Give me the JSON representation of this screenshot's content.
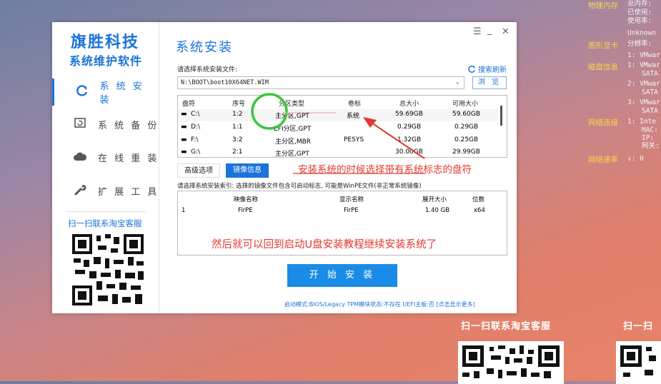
{
  "desktop": {
    "sysinfo": [
      {
        "key": "物理内存",
        "values": [
          "总内存:",
          "已使用:",
          "使用率:",
          "Unknown"
        ]
      },
      {
        "key": "图形显卡",
        "values": [
          "分辨率:",
          "1: VMwar"
        ]
      },
      {
        "key": "磁盘信息",
        "values": [
          "1: VMwar",
          "SATA",
          "2: VMwar",
          "SATA",
          "3: VMwar",
          "SATA"
        ]
      },
      {
        "key": "网络连接",
        "values": [
          "1: Inte",
          "MAC:",
          "IP:",
          "网关:"
        ]
      },
      {
        "key": "网络速率",
        "values": [
          "↓: 0"
        ]
      }
    ],
    "qr_label_1": "扫一扫联系淘宝客服",
    "qr_label_2": "扫一扫"
  },
  "window": {
    "brand_line1": "旗胜科技",
    "brand_line2": "系统维护软件",
    "nav": [
      {
        "label": "系 统 安 装",
        "icon": "refresh-icon",
        "active": true
      },
      {
        "label": "系 统 备 份",
        "icon": "backup-icon",
        "active": false
      },
      {
        "label": "在 线 重 装",
        "icon": "cloud-icon",
        "active": false
      },
      {
        "label": "扩 展 工 具",
        "icon": "wrench-icon",
        "active": false
      }
    ],
    "side_qr_label": "扫一扫联系淘宝客服",
    "controls": {
      "menu": "☰",
      "minimize": "_",
      "close": "✕"
    },
    "title": "系统安装",
    "select_file_label": "请选择系统安装文件:",
    "search_refresh": "搜索刷新",
    "file_path": "N:\\BOOT\\boot10X64NET.WIM",
    "browse_label": "浏 览",
    "partition_headers": [
      "盘符",
      "序号",
      "分区类型",
      "卷标",
      "总大小",
      "可用大小"
    ],
    "partitions": [
      {
        "drive": "C:\\",
        "index": "1:2",
        "type": "主分区,GPT",
        "label": "系统",
        "total": "59.69GB",
        "free": "59.60GB"
      },
      {
        "drive": "D:\\",
        "index": "1:1",
        "type": "EFI分区,GPT",
        "label": "",
        "total": "0.29GB",
        "free": "0.29GB"
      },
      {
        "drive": "F:\\",
        "index": "3:2",
        "type": "主分区,MBR",
        "label": "PESYS",
        "total": "1.32GB",
        "free": "0.25GB"
      },
      {
        "drive": "G:\\",
        "index": "2:1",
        "type": "主分区,GPT",
        "label": "",
        "total": "30.00GB",
        "free": "29.99GB"
      }
    ],
    "tab_advanced": "高级选项",
    "tab_image_info": "镜像信息",
    "image_index_label": "请选择系统安装索引: 选择的镜像文件包含可启动标志, 可能是WinPE文件(非正常系统镜像)",
    "image_headers": [
      "映像名称",
      "显示名称",
      "展开大小",
      "位数"
    ],
    "images": [
      {
        "index": "1",
        "name": "FirPE",
        "display": "FirPE",
        "size": "1.40 GB",
        "bits": "x64"
      }
    ],
    "start_button": "开 始 安 装",
    "status_bar": "启动模式:BIOS/Legacy TPM模块状态:不存在 UEFI主板:否 [点击显示更多]"
  },
  "annotations": {
    "note1": "安装系统的时候选择带有系统标志的盘符",
    "note2": "然后就可以回到启动U盘安装教程继续安装系统了",
    "color": "#e03a2f",
    "circle_color": "#3cc63c"
  }
}
